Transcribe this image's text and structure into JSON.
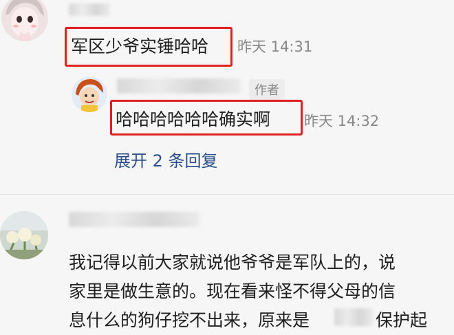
{
  "comments": [
    {
      "text": "军区少爷实锤哈哈",
      "time": "昨天 14:31",
      "reply": {
        "badge": "作者",
        "text": "哈哈哈哈哈哈确实啊",
        "time": "昨天 14:32"
      },
      "expand_label": "展开 2 条回复"
    },
    {
      "lines": [
        "我记得以前大家就说他爷爷是军队上的，说",
        "家里是做生意的。现在看来怪不得父母的信",
        "息什么的狗仔挖不出来，原来是"
      ],
      "line3_tail": "保护起"
    }
  ],
  "colors": {
    "highlight": "#e02020",
    "link": "#2a4f8c",
    "muted": "#888888"
  },
  "icons": {
    "avatar1": "anime-girl-avatar",
    "avatar2": "cartoon-avatar",
    "avatar3": "flower-photo-avatar"
  }
}
